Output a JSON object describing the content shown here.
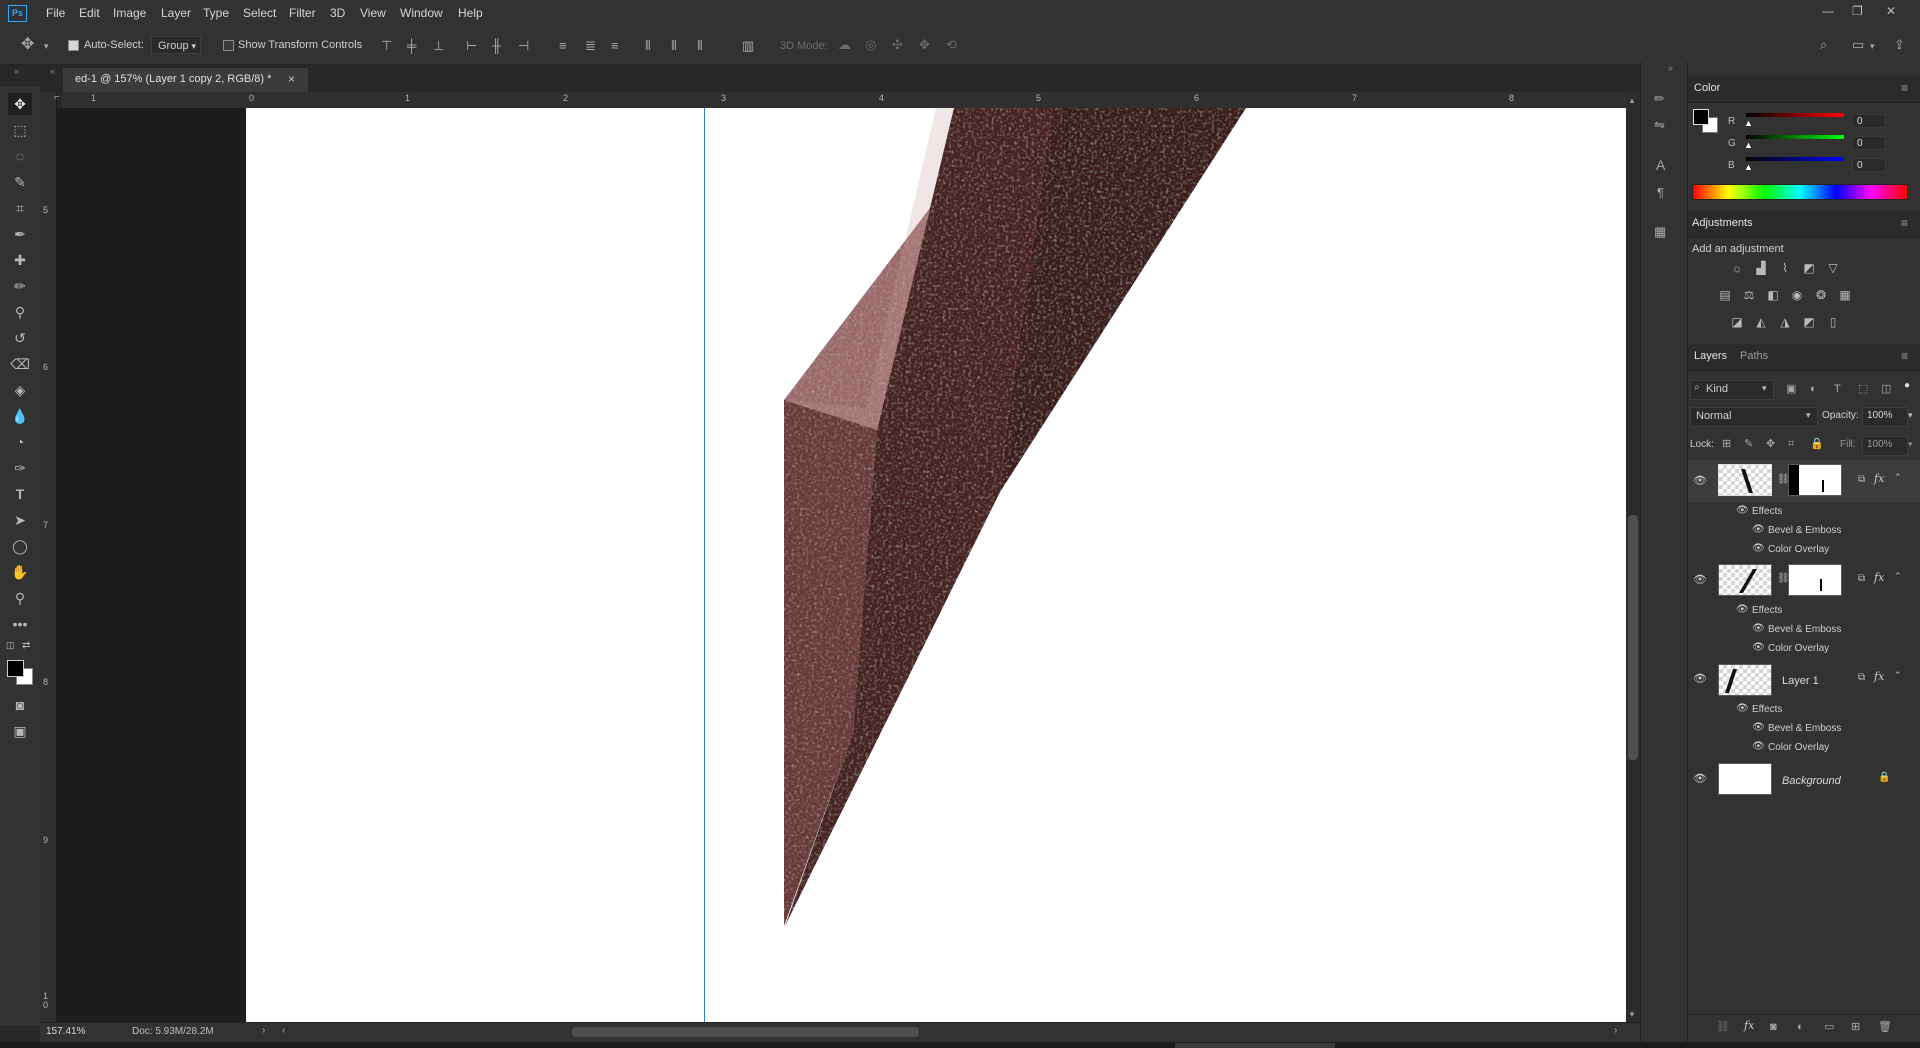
{
  "menu": {
    "items": [
      "File",
      "Edit",
      "Image",
      "Layer",
      "Type",
      "Select",
      "Filter",
      "3D",
      "View",
      "Window",
      "Help"
    ]
  },
  "options": {
    "auto_select_label": "Auto-Select:",
    "auto_select_value": "Group",
    "show_transform_label": "Show Transform Controls",
    "mode_3d_label": "3D Mode:"
  },
  "document": {
    "tab_title": "ed-1 @ 157% (Layer 1 copy 2, RGB/8) *",
    "h_ruler_labels": [
      "1",
      "0",
      "1",
      "2",
      "3",
      "4",
      "5",
      "6",
      "7",
      "8"
    ],
    "v_ruler_labels": [
      "5",
      "6",
      "7",
      "8",
      "9",
      "1\n0"
    ]
  },
  "status": {
    "zoom": "157.41%",
    "doc_size": "Doc: 5.93M/28.2M"
  },
  "color_panel": {
    "title": "Color",
    "channels": [
      {
        "label": "R",
        "value": "0"
      },
      {
        "label": "G",
        "value": "0"
      },
      {
        "label": "B",
        "value": "0"
      }
    ]
  },
  "adjustments_panel": {
    "title": "Adjustments",
    "subtitle": "Add an adjustment"
  },
  "layers_panel": {
    "tabs": [
      "Layers",
      "Paths"
    ],
    "filter_kind": "Kind",
    "blend_mode": "Normal",
    "opacity_label": "Opacity:",
    "opacity_value": "100%",
    "lock_label": "Lock:",
    "fill_label": "Fill:",
    "fill_value": "100%",
    "layers": [
      {
        "name": "",
        "effects_label": "Effects",
        "effects": [
          "Bevel & Emboss",
          "Color Overlay"
        ],
        "selected": true
      },
      {
        "name": "",
        "effects_label": "Effects",
        "effects": [
          "Bevel & Emboss",
          "Color Overlay"
        ],
        "selected": false
      },
      {
        "name": "Layer 1",
        "effects_label": "Effects",
        "effects": [
          "Bevel & Emboss",
          "Color Overlay"
        ],
        "selected": false
      },
      {
        "name": "Background",
        "effects_label": "",
        "effects": [],
        "selected": false
      }
    ]
  },
  "colors": {
    "accent": "#31a8ff",
    "shape_light": "#9a6a6a",
    "shape_dark": "#4a2323",
    "guide": "#2e7cd1"
  }
}
